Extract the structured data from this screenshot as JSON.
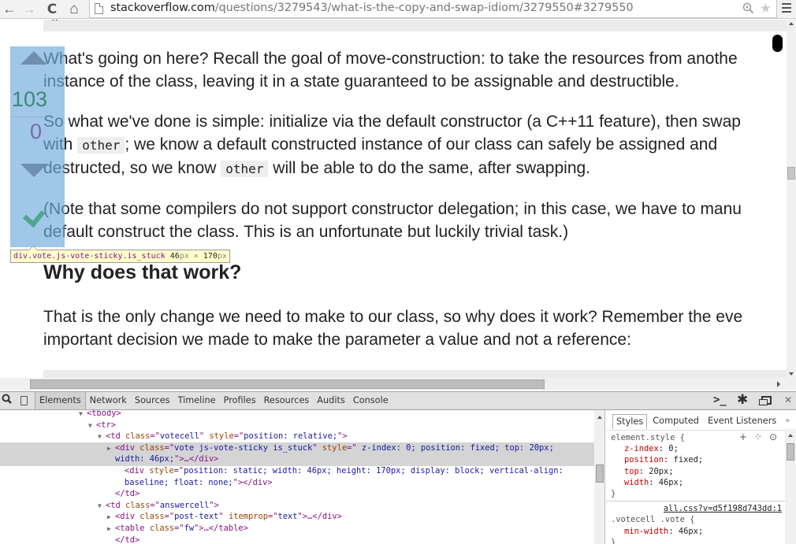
{
  "browser": {
    "nav": {
      "back": "←",
      "forward": "→",
      "reload": "C",
      "home": "⌂"
    },
    "url": {
      "host": "stackoverflow.com",
      "path": "/questions/3279543/what-is-the-copy-and-swap-idiom/3279550#3279550"
    },
    "icons": {
      "zoom": "zoom-icon",
      "star": "bookmark-star-icon",
      "menu": "hamburger-menu-icon"
    }
  },
  "page": {
    "paragraphs": [
      {
        "lines": [
          "What's going on here? Recall the goal of move-construction: to take the resources from anothe",
          "instance of the class, leaving it in a state guaranteed to be assignable and destructible."
        ]
      },
      {
        "line1": "So what we've done is simple: initialize via the default constructor (a C++11 feature), then swap",
        "line2_pre": "with ",
        "line2_code": "other",
        "line2_post": "; we know a default constructed instance of our class can safely be assigned and",
        "line3_pre": "destructed, so we know ",
        "line3_code": "other",
        "line3_post": " will be able to do the same, after swapping."
      },
      {
        "lines": [
          "(Note that some compilers do not support constructor delegation; in this case, we have to manu",
          "default construct the class. This is an unfortunate but luckily trivial task.)"
        ]
      }
    ],
    "heading": "Why does that work?",
    "last_paragraph": [
      "That is the only change we need to make to our class, so why does it work? Remember the eve",
      "important decision we made to make the parameter a value and not a reference:"
    ],
    "vote": {
      "score": "103",
      "favorites": "0",
      "accepted": true,
      "colors": {
        "score": "#3a8a7a",
        "accepted": "#4fa68e",
        "highlight": "#6fa8dc"
      }
    },
    "inspect_tooltip": {
      "selector": "div.vote.js-vote-sticky.is_stuck",
      "width": "46",
      "height": "170",
      "unit": "px",
      "times": "×"
    }
  },
  "devtools": {
    "tabs": [
      "Elements",
      "Network",
      "Sources",
      "Timeline",
      "Profiles",
      "Resources",
      "Audits",
      "Console"
    ],
    "active_tab": "Elements",
    "dom": [
      {
        "indent": 0,
        "tri": "▼",
        "html": "<tbody>"
      },
      {
        "indent": 1,
        "tri": "▼",
        "html": "<tr>"
      },
      {
        "indent": 2,
        "tri": "▼",
        "tag": "td",
        "attrs": [
          [
            "class",
            "votecell"
          ],
          [
            "style",
            "position: relative;"
          ]
        ],
        "close": ">"
      },
      {
        "indent": 3,
        "tri": "▶",
        "tag": "div",
        "attrs": [
          [
            "class",
            "vote js-vote-sticky is_stuck"
          ],
          [
            "style",
            " z-index: 0; position: fixed; top: 20px;"
          ]
        ],
        "selected": true
      },
      {
        "indent": 3,
        "cont": true,
        "text": "width: 46px;\">…</div>",
        "selected": true
      },
      {
        "indent": 4,
        "tag": "div",
        "attrs": [
          [
            "style",
            "position: static; width: 46px; height: 170px; display: block; vertical-align:"
          ]
        ]
      },
      {
        "indent": 4,
        "cont": true,
        "text": "baseline; float: none;\"></div>"
      },
      {
        "indent": 3,
        "tri": "",
        "html": "</td>"
      },
      {
        "indent": 2,
        "tri": "▼",
        "tag": "td",
        "attrs": [
          [
            "class",
            "answercell"
          ]
        ],
        "close": ">"
      },
      {
        "indent": 3,
        "tri": "▶",
        "tag": "div",
        "attrs": [
          [
            "class",
            "post-text"
          ],
          [
            "itemprop",
            "text"
          ]
        ],
        "close": ">…</div>"
      },
      {
        "indent": 3,
        "tri": "▶",
        "tag": "table",
        "attrs": [
          [
            "class",
            "fw"
          ]
        ],
        "close": ">…</table>"
      },
      {
        "indent": 3,
        "tri": "",
        "html": "</td>"
      }
    ],
    "styles": {
      "tabs": [
        "Styles",
        "Computed",
        "Event Listeners"
      ],
      "more": "»",
      "rules": [
        {
          "selector": "element.style {",
          "props": [
            [
              "z-index",
              "0"
            ],
            [
              "position",
              "fixed"
            ],
            [
              "top",
              "20px"
            ],
            [
              "width",
              "46px"
            ]
          ],
          "close": "}"
        },
        {
          "source": "all.css?v=d5f198d743dd:1",
          "selector": ".votecell .vote {",
          "props": [
            [
              "min-width",
              "46px"
            ]
          ],
          "close": "}"
        }
      ]
    }
  }
}
